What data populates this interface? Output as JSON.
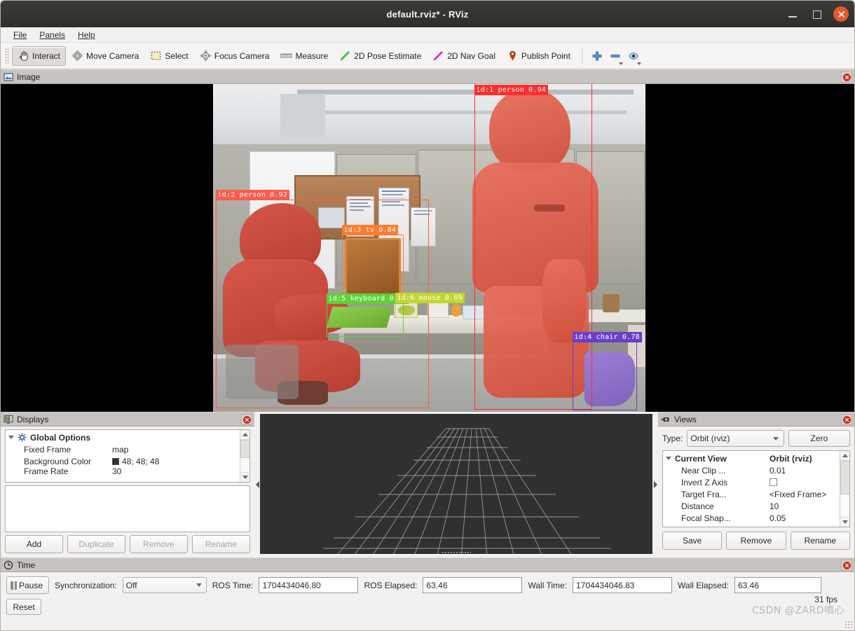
{
  "window": {
    "title": "default.rviz* - RViz",
    "controls": {
      "minimize": "minimize-button",
      "maximize": "maximize-button",
      "close": "close-button"
    }
  },
  "menubar": {
    "items": [
      {
        "label": "File",
        "mnemonic": "F"
      },
      {
        "label": "Panels",
        "mnemonic": "P"
      },
      {
        "label": "Help",
        "mnemonic": "H"
      }
    ]
  },
  "toolbar": {
    "tools": [
      {
        "label": "Interact",
        "icon": "hand-cursor-icon",
        "active": true
      },
      {
        "label": "Move Camera",
        "icon": "move-camera-icon",
        "active": false
      },
      {
        "label": "Select",
        "icon": "selection-rect-icon",
        "active": false
      },
      {
        "label": "Focus Camera",
        "icon": "focus-camera-icon",
        "active": false
      },
      {
        "label": "Measure",
        "icon": "ruler-icon",
        "active": false
      },
      {
        "label": "2D Pose Estimate",
        "icon": "green-arrow-icon",
        "active": false
      },
      {
        "label": "2D Nav Goal",
        "icon": "magenta-arrow-icon",
        "active": false
      },
      {
        "label": "Publish Point",
        "icon": "map-pin-icon",
        "active": false
      }
    ],
    "extra_buttons": [
      {
        "icon": "plus-icon",
        "name": "add-tool-button"
      },
      {
        "icon": "minus-icon",
        "name": "remove-tool-button"
      },
      {
        "icon": "eye-icon",
        "name": "visibility-button"
      }
    ]
  },
  "image_panel": {
    "title": "Image",
    "icon": "image-panel-icon",
    "close": "x",
    "detections": [
      {
        "id": "id:1",
        "class": "person",
        "score": "0.94",
        "label": "id:1 person 0.94",
        "color": "#ff2d2d"
      },
      {
        "id": "id:2",
        "class": "person",
        "score": "0.92",
        "label": "id:2 person 0.92",
        "color": "#ff5b4a"
      },
      {
        "id": "id:3",
        "class": "tv",
        "score": "0.84",
        "label": "id:3 tv 0.84",
        "color": "#ff7a2e"
      },
      {
        "id": "id:5",
        "class": "keyboard",
        "score": "0.74",
        "label": "id:5 keyboard 0.74",
        "color": "#5fd03a"
      },
      {
        "id": "id:6",
        "class": "mouse",
        "score": "0.69",
        "label": "id:6 mouse 0.69",
        "color": "#c4d62e"
      },
      {
        "id": "id:4",
        "class": "chair",
        "score": "0.78",
        "label": "id:4 chair 0.78",
        "color": "#6b3fc9"
      }
    ]
  },
  "displays_panel": {
    "title": "Displays",
    "icon": "displays-panel-icon",
    "close": "x",
    "tree": [
      {
        "name": "Global Options",
        "value": "",
        "bold": true,
        "icon": "gear-icon",
        "twisty": true
      },
      {
        "name": "Fixed Frame",
        "value": "map"
      },
      {
        "name": "Background Color",
        "value": "48; 48; 48",
        "swatch": "#303030"
      },
      {
        "name": "Frame Rate",
        "value": "30"
      }
    ],
    "buttons": [
      {
        "label": "Add",
        "enabled": true
      },
      {
        "label": "Duplicate",
        "enabled": false
      },
      {
        "label": "Remove",
        "enabled": false
      },
      {
        "label": "Rename",
        "enabled": false
      }
    ]
  },
  "views_panel": {
    "title": "Views",
    "icon": "views-panel-icon",
    "close": "x",
    "type_label": "Type:",
    "type_value": "Orbit (rviz)",
    "zero_label": "Zero",
    "tree": [
      {
        "name": "Current View",
        "value": "Orbit (rviz)",
        "bold": true,
        "twisty": true
      },
      {
        "name": "Near Clip ...",
        "value": "0.01"
      },
      {
        "name": "Invert Z Axis",
        "value": "",
        "checkbox": true
      },
      {
        "name": "Target Fra...",
        "value": "<Fixed Frame>"
      },
      {
        "name": "Distance",
        "value": "10"
      },
      {
        "name": "Focal Shap...",
        "value": "0.05"
      }
    ],
    "buttons": [
      {
        "label": "Save"
      },
      {
        "label": "Remove"
      },
      {
        "label": "Rename"
      }
    ]
  },
  "time_panel": {
    "title": "Time",
    "icon": "clock-icon",
    "close": "x",
    "pause_label": "Pause",
    "sync_label": "Synchronization:",
    "sync_value": "Off",
    "fields": [
      {
        "label": "ROS Time:",
        "value": "1704434046.80"
      },
      {
        "label": "ROS Elapsed:",
        "value": "63.46"
      },
      {
        "label": "Wall Time:",
        "value": "1704434046.83"
      },
      {
        "label": "Wall Elapsed:",
        "value": "63.46"
      }
    ],
    "reset_label": "Reset",
    "fps": "31 fps",
    "watermark": "CSDN @ZARD噴心"
  },
  "colors": {
    "titlebar": "#2f2e2b",
    "close_button": "#e8562a",
    "panel_header": "#c6c3c0",
    "render_background": "#303030",
    "grid": "#a8a8a8"
  }
}
